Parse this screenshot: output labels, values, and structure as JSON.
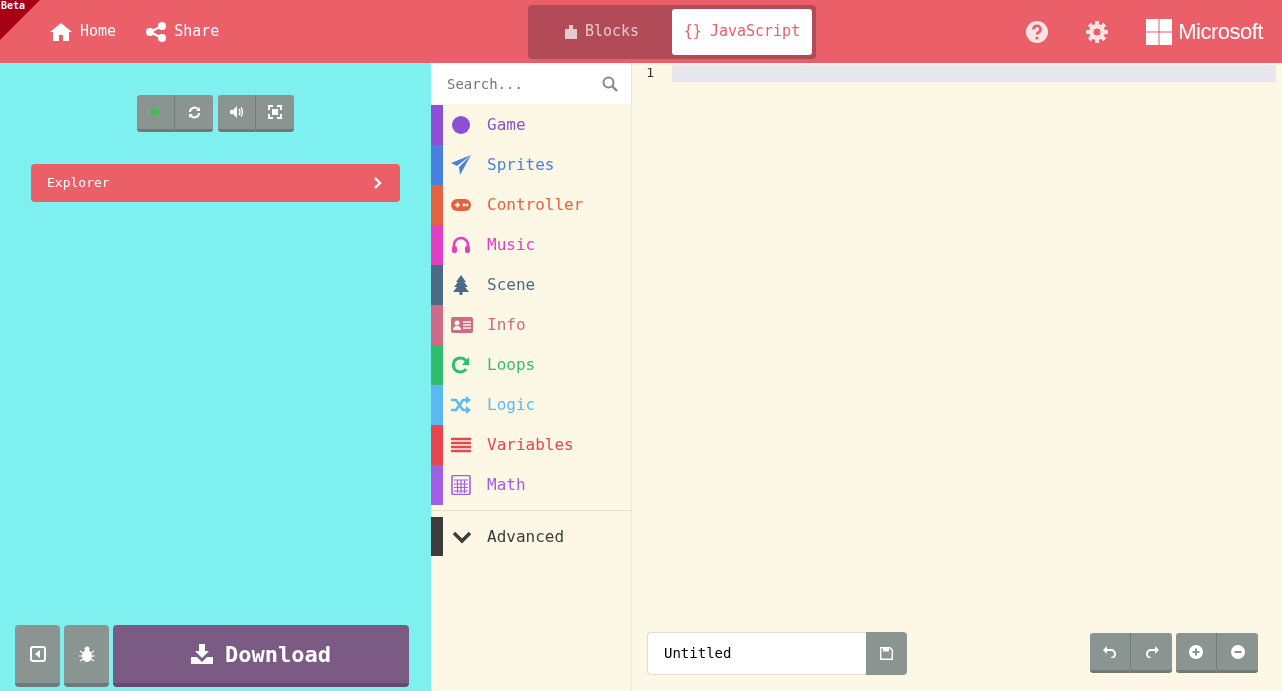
{
  "beta_badge": "Beta",
  "nav": [
    {
      "label": "Home"
    },
    {
      "label": "Share"
    }
  ],
  "editor_tabs": [
    {
      "label": "Blocks",
      "selected": false
    },
    {
      "label": "JavaScript",
      "icon_text": "{}",
      "selected": true
    }
  ],
  "brand": "Microsoft",
  "explorer": {
    "label": "Explorer"
  },
  "download_button": "Download",
  "toolbox": {
    "search": {
      "placeholder": "Search..."
    },
    "categories": [
      {
        "label": "Game",
        "color": "#8e4fd6"
      },
      {
        "label": "Sprites",
        "color": "#4a80e0"
      },
      {
        "label": "Controller",
        "color": "#e5623f"
      },
      {
        "label": "Music",
        "color": "#e33fc2"
      },
      {
        "label": "Scene",
        "color": "#4c6a85"
      },
      {
        "label": "Info",
        "color": "#cf6a87"
      },
      {
        "label": "Loops",
        "color": "#2fbe6e"
      },
      {
        "label": "Logic",
        "color": "#5cb8f2"
      },
      {
        "label": "Variables",
        "color": "#e8464f"
      },
      {
        "label": "Math",
        "color": "#a25ee6"
      }
    ],
    "advanced": {
      "label": "Advanced",
      "color": "#3c3c3c"
    }
  },
  "editor": {
    "line_numbers": [
      "1"
    ]
  },
  "project_name": {
    "value": "Untitled"
  }
}
